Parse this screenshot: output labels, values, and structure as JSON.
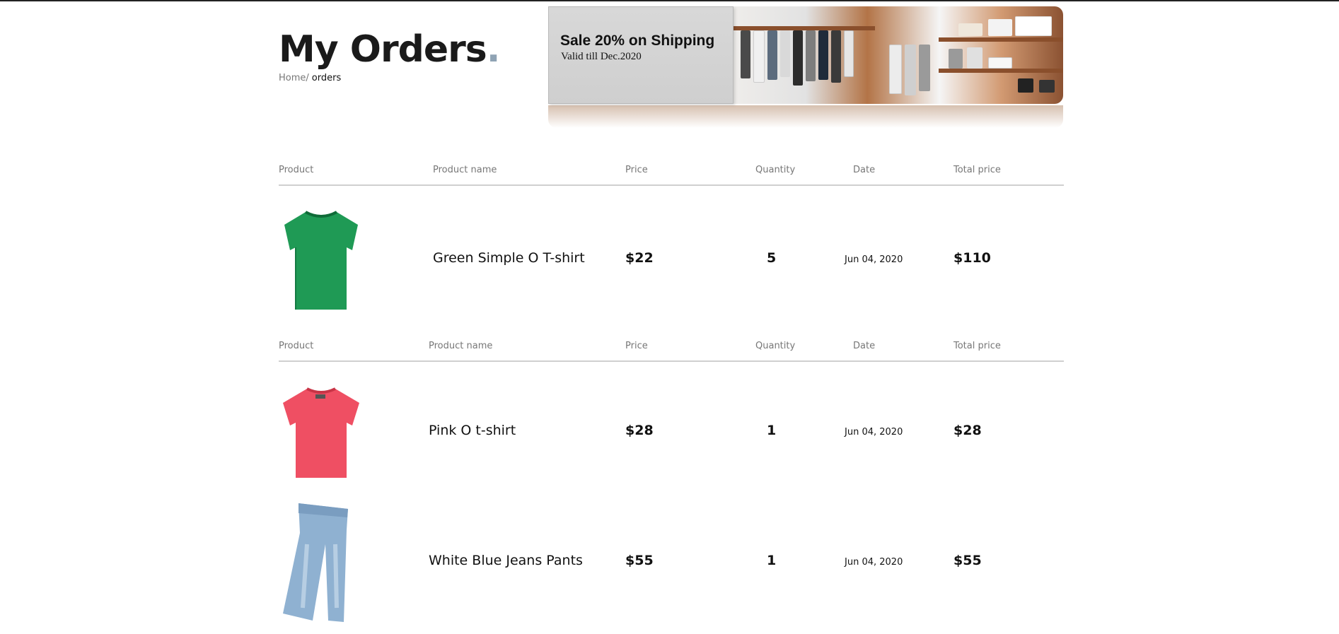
{
  "header": {
    "title": "My Orders",
    "title_dot": ".",
    "breadcrumb": {
      "home": "Home/",
      "current": "orders"
    }
  },
  "banner": {
    "headline": "Sale 20% on Shipping",
    "subtext": "Valid till Dec.2020"
  },
  "table": {
    "columns": [
      "Product",
      "Product name",
      "Price",
      "Quantity",
      "Date",
      "Total price"
    ],
    "orders": [
      {
        "items": [
          {
            "image": "green-tshirt-image",
            "color": "#1f9a55",
            "name": "Green Simple O T-shirt",
            "price": "$22",
            "quantity": "5",
            "date": "Jun 04, 2020",
            "total": "$110"
          }
        ]
      },
      {
        "items": [
          {
            "image": "pink-tshirt-image",
            "color": "#ef4f63",
            "name": "Pink O t-shirt",
            "price": "$28",
            "quantity": "1",
            "date": "Jun 04, 2020",
            "total": "$28"
          },
          {
            "image": "jeans-image",
            "color": "#8fb1d1",
            "name": "White Blue Jeans Pants",
            "price": "$55",
            "quantity": "1",
            "date": "Jun 04, 2020",
            "total": "$55"
          }
        ]
      }
    ]
  }
}
